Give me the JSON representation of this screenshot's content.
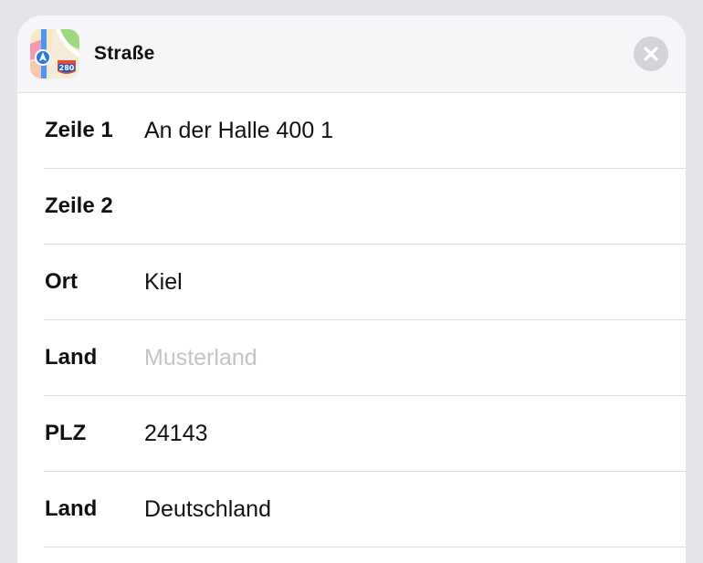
{
  "header": {
    "title": "Straße",
    "app_icon": "maps-app-icon",
    "close_icon": "close-icon"
  },
  "fields": [
    {
      "label": "Zeile 1",
      "value": "An der Halle 400 1",
      "placeholder": ""
    },
    {
      "label": "Zeile 2",
      "value": "",
      "placeholder": ""
    },
    {
      "label": "Ort",
      "value": "Kiel",
      "placeholder": ""
    },
    {
      "label": "Land",
      "value": "",
      "placeholder": "Musterland"
    },
    {
      "label": "PLZ",
      "value": "24143",
      "placeholder": ""
    },
    {
      "label": "Land",
      "value": "Deutschland",
      "placeholder": ""
    }
  ],
  "colors": {
    "background": "#e4e5ea",
    "sheet": "#ffffff",
    "header": "#f6f6f8",
    "placeholder": "#c3c3c8",
    "close_button": "#d3d3d8"
  }
}
